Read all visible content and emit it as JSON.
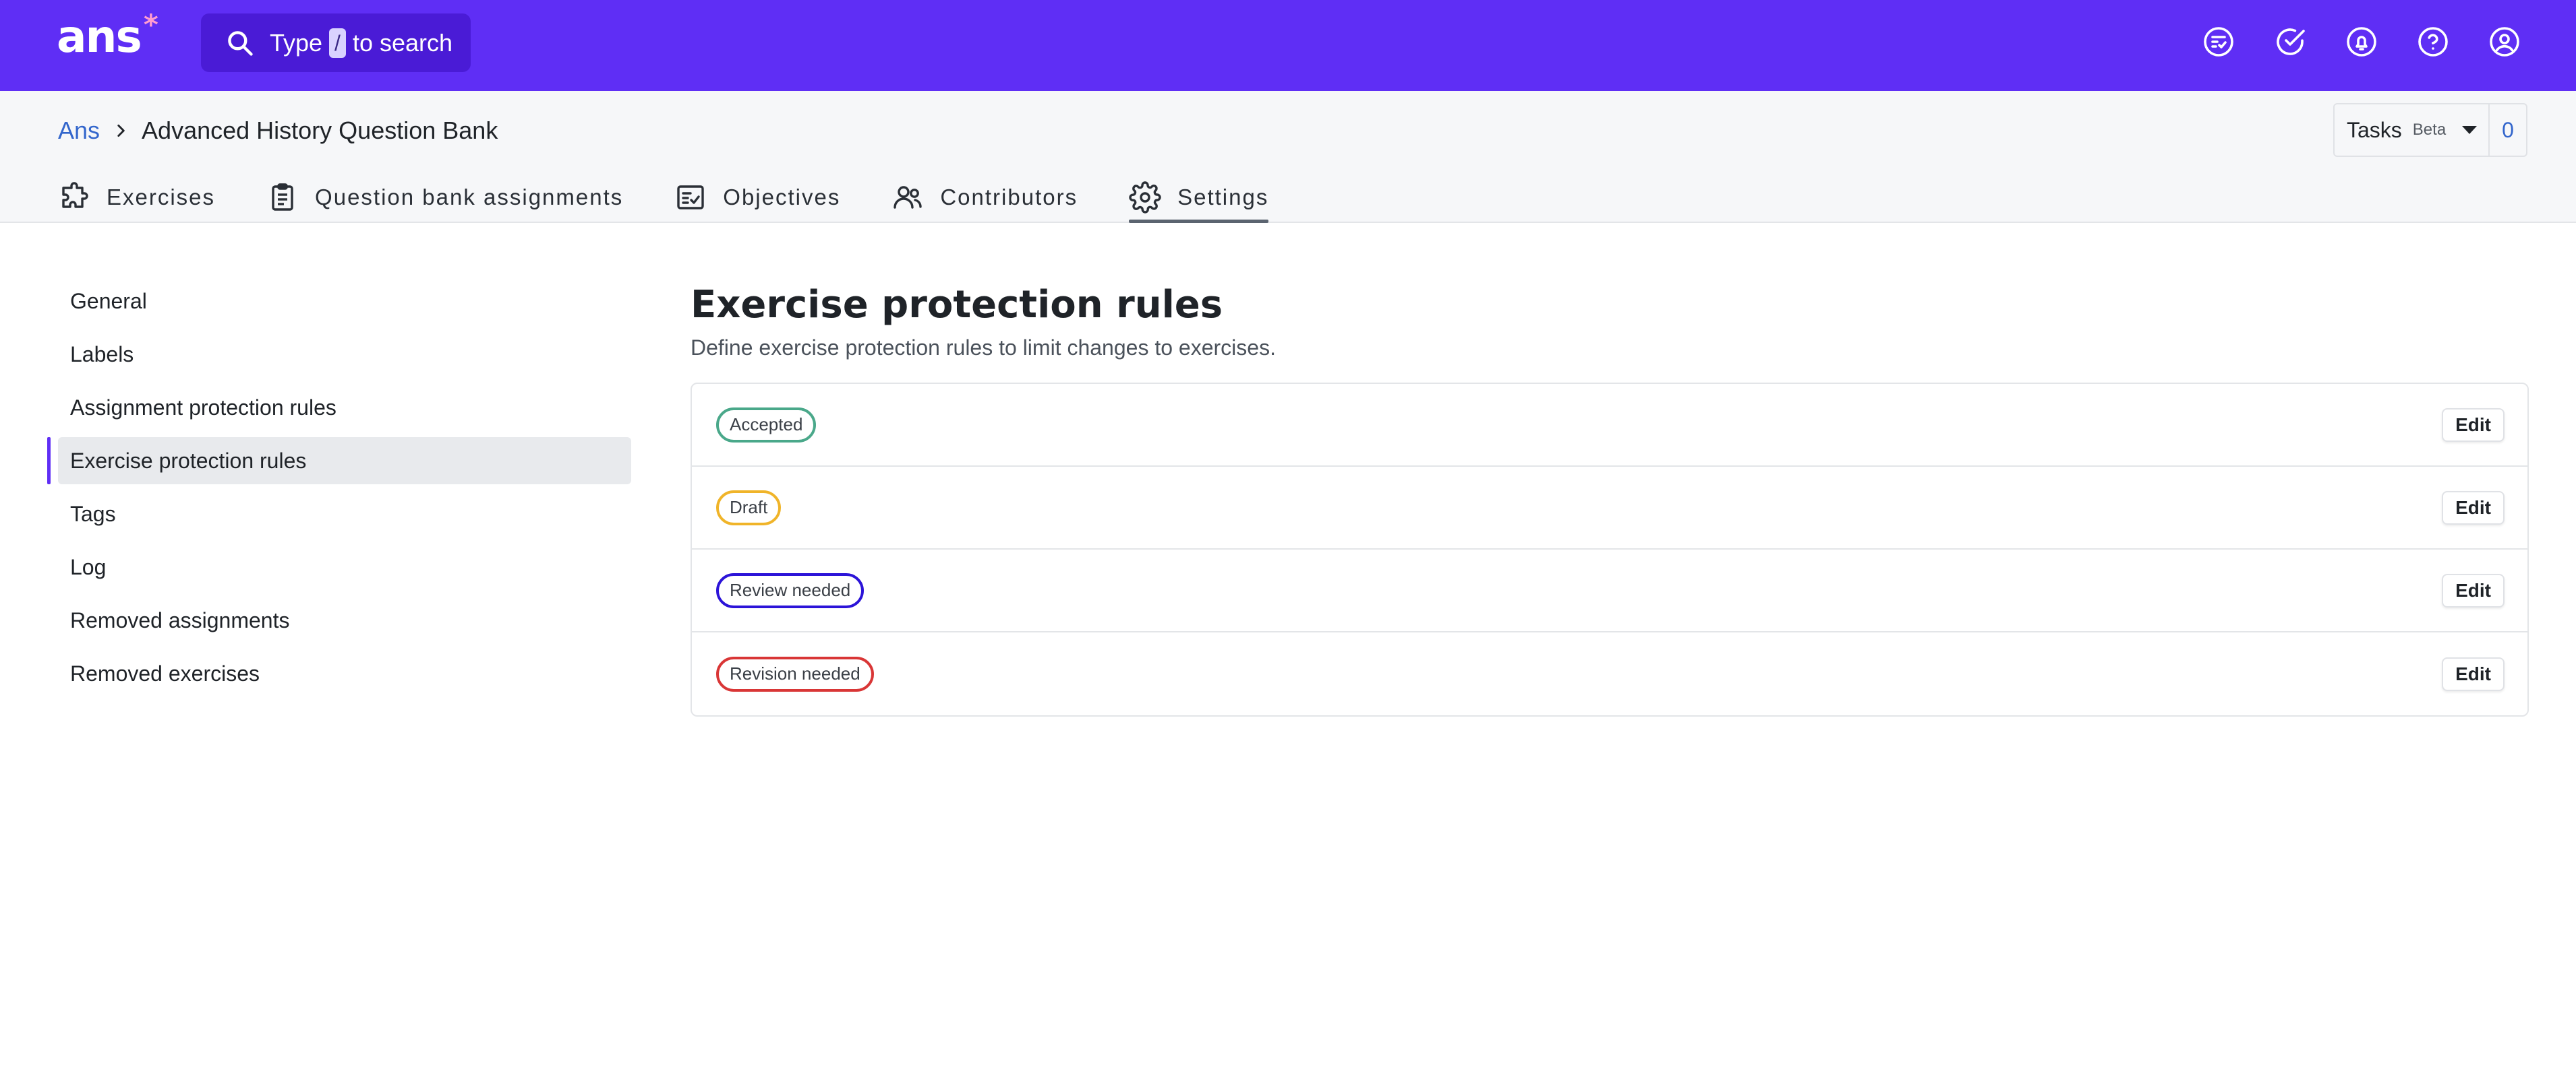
{
  "app": {
    "logo_text": "ans",
    "logo_mark": "*",
    "search": {
      "prefix": "Type",
      "key": "/",
      "suffix": "to search"
    },
    "top_icons": [
      "checklist-icon",
      "check-circle-icon",
      "bell-icon",
      "help-icon",
      "user-icon"
    ]
  },
  "breadcrumb": {
    "root": "Ans",
    "current": "Advanced History Question Bank"
  },
  "tasks": {
    "label": "Tasks",
    "beta": "Beta",
    "count": "0"
  },
  "tabs": [
    {
      "label": "Exercises",
      "icon": "puzzle-icon"
    },
    {
      "label": "Question bank assignments",
      "icon": "clipboard-icon"
    },
    {
      "label": "Objectives",
      "icon": "checklist-icon"
    },
    {
      "label": "Contributors",
      "icon": "users-icon"
    },
    {
      "label": "Settings",
      "icon": "gear-icon",
      "active": true
    }
  ],
  "settings_nav": [
    {
      "label": "General"
    },
    {
      "label": "Labels"
    },
    {
      "label": "Assignment protection rules"
    },
    {
      "label": "Exercise protection rules",
      "active": true
    },
    {
      "label": "Tags"
    },
    {
      "label": "Log"
    },
    {
      "label": "Removed assignments"
    },
    {
      "label": "Removed exercises"
    }
  ],
  "main": {
    "title": "Exercise protection rules",
    "description": "Define exercise protection rules to limit changes to exercises.",
    "edit_label": "Edit",
    "rules": [
      {
        "status": "Accepted",
        "color": "#4aa88a"
      },
      {
        "status": "Draft",
        "color": "#f0b429"
      },
      {
        "status": "Review needed",
        "color": "#2c14d8"
      },
      {
        "status": "Revision needed",
        "color": "#d93636"
      }
    ]
  },
  "colors": {
    "brand": "#5f2ef5",
    "search_bg": "#4a1bd6",
    "link": "#3366cc"
  }
}
